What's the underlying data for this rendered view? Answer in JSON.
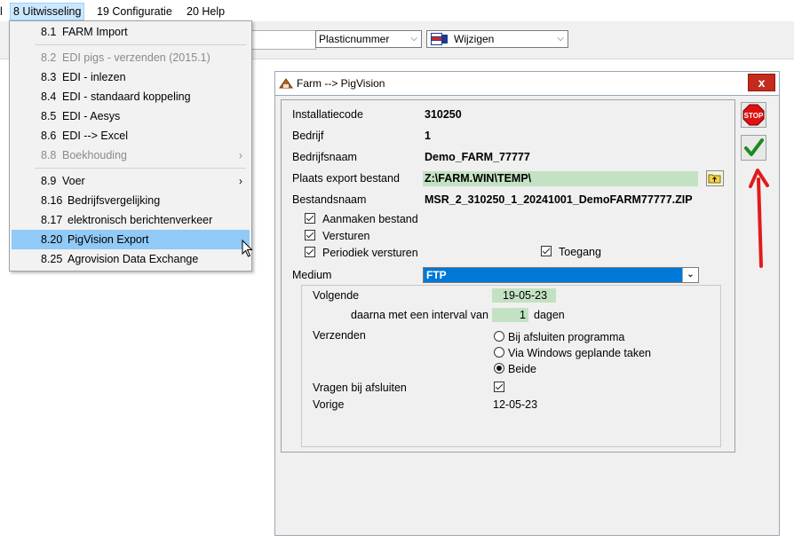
{
  "menubar": {
    "stub": "l",
    "items": [
      {
        "label": "8  Uitwisseling"
      },
      {
        "label": "19  Configuratie"
      },
      {
        "label": "20  Help"
      }
    ]
  },
  "toolbar": {
    "field_select": "Plasticnummer",
    "action_select": "Wijzigen"
  },
  "menu": {
    "items": [
      {
        "num": "8.1",
        "label": "FARM Import"
      },
      {
        "num": "8.2",
        "label": "EDI pigs - verzenden (2015.1)"
      },
      {
        "num": "8.3",
        "label": "EDI - inlezen"
      },
      {
        "num": "8.4",
        "label": "EDI - standaard koppeling"
      },
      {
        "num": "8.5",
        "label": "EDI - Aesys"
      },
      {
        "num": "8.6",
        "label": "EDI --> Excel"
      },
      {
        "num": "8.8",
        "label": "Boekhouding"
      },
      {
        "num": "8.9",
        "label": "Voer"
      },
      {
        "num": "8.16",
        "label": "Bedrijfsvergelijking"
      },
      {
        "num": "8.17",
        "label": "elektronisch berichtenverkeer"
      },
      {
        "num": "8.20",
        "label": "PigVision Export"
      },
      {
        "num": "8.25",
        "label": "Agrovision Data Exchange"
      }
    ]
  },
  "dialog": {
    "title": "Farm --> PigVision",
    "close": "x",
    "labels": {
      "installatiecode": "Installatiecode",
      "bedrijf": "Bedrijf",
      "bedrijfsnaam": "Bedrijfsnaam",
      "plaats": "Plaats export bestand",
      "bestandsnaam": "Bestandsnaam",
      "medium": "Medium"
    },
    "values": {
      "installatiecode": "310250",
      "bedrijf": "1",
      "bedrijfsnaam": "Demo_FARM_77777",
      "plaats": "Z:\\FARM.WIN\\TEMP\\",
      "bestandsnaam": "MSR_2_310250_1_20241001_DemoFARM77777.ZIP",
      "medium": "FTP"
    },
    "checkboxes": {
      "aanmaken": {
        "label": "Aanmaken bestand",
        "checked": true
      },
      "versturen": {
        "label": "Versturen",
        "checked": true
      },
      "periodiek": {
        "label": "Periodiek versturen",
        "checked": true
      },
      "toegang": {
        "label": "Toegang",
        "checked": true
      }
    },
    "schedule": {
      "volgende_label": "Volgende",
      "volgende_value": "19-05-23",
      "interval_label": "daarna met een interval van",
      "interval_value": "1",
      "interval_unit": "dagen",
      "verzenden_label": "Verzenden",
      "options": [
        {
          "label": "Bij afsluiten programma",
          "selected": false
        },
        {
          "label": "Via Windows geplande taken",
          "selected": false
        },
        {
          "label": "Beide",
          "selected": true
        }
      ],
      "vragen_label": "Vragen bij afsluiten",
      "vragen_checked": true,
      "vorige_label": "Vorige",
      "vorige_value": "12-05-23"
    },
    "buttons": {
      "stop": "STOP"
    }
  },
  "colors": {
    "accent": "#0078d7",
    "menu_highlight": "#91c9f7",
    "field_green": "#c3e1c3",
    "arrow_red": "#e11b1b",
    "close_red": "#c42b1c"
  }
}
